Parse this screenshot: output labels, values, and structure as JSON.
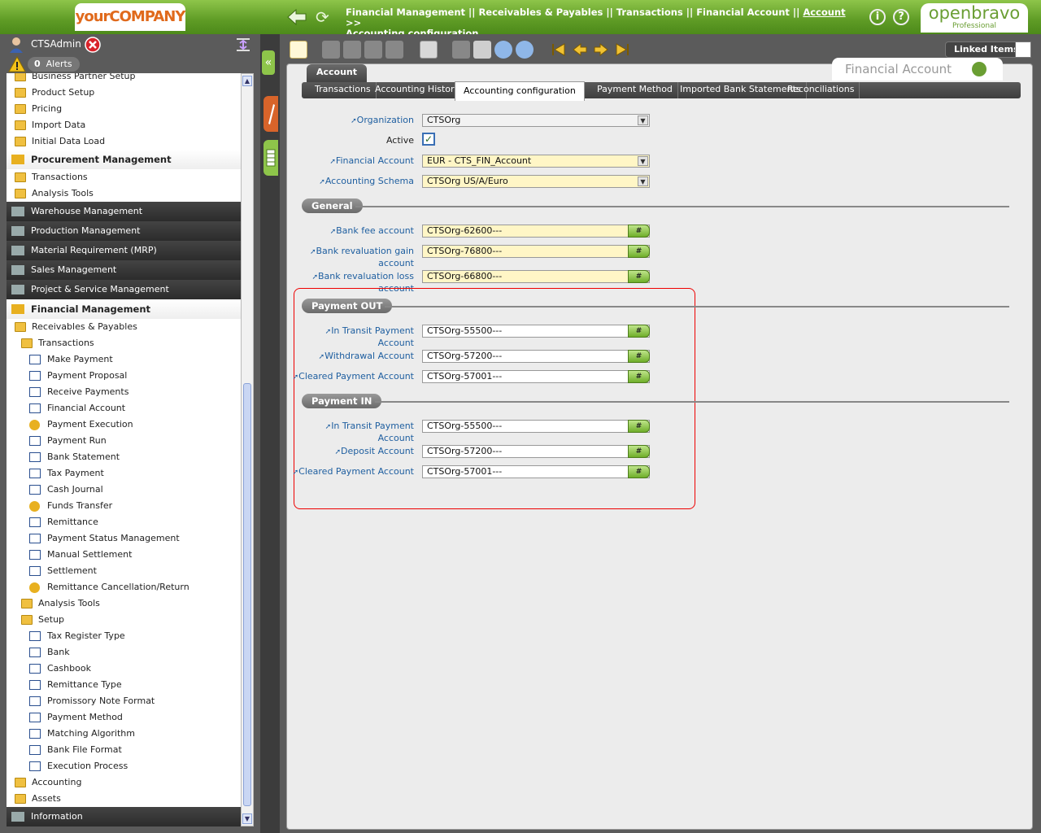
{
  "header": {
    "company_logo": "yourCOMPANY",
    "breadcrumb_line1": "Financial Management || Receivables & Payables || Transactions || Financial Account ||",
    "breadcrumb_link": "Account",
    "breadcrumb_sep": ">>",
    "breadcrumb_line2": "Accounting configuration",
    "brand_name": "openbravo",
    "brand_edition": "Professional",
    "info_label": "i",
    "help_label": "?"
  },
  "user": {
    "name": "CTSAdmin",
    "alerts_count": "0",
    "alerts_label": "Alerts"
  },
  "menu": [
    {
      "label": "Business Partner Setup",
      "type": "folder",
      "indent": 1
    },
    {
      "label": "Product Setup",
      "type": "folder",
      "indent": 1
    },
    {
      "label": "Pricing",
      "type": "folder",
      "indent": 1
    },
    {
      "label": "Import Data",
      "type": "folder",
      "indent": 1
    },
    {
      "label": "Initial Data Load",
      "type": "folder",
      "indent": 1
    },
    {
      "label": "Procurement Management",
      "type": "section"
    },
    {
      "label": "Transactions",
      "type": "folder",
      "indent": 1
    },
    {
      "label": "Analysis Tools",
      "type": "folder",
      "indent": 1
    },
    {
      "label": "Warehouse Management",
      "type": "dark"
    },
    {
      "label": "Production Management",
      "type": "dark"
    },
    {
      "label": "Material Requirement (MRP)",
      "type": "dark"
    },
    {
      "label": "Sales Management",
      "type": "dark"
    },
    {
      "label": "Project & Service Management",
      "type": "dark"
    },
    {
      "label": "Financial Management",
      "type": "section"
    },
    {
      "label": "Receivables & Payables",
      "type": "folder",
      "indent": 1
    },
    {
      "label": "Transactions",
      "type": "folder",
      "indent": 2
    },
    {
      "label": "Make Payment",
      "type": "doc",
      "indent": 3
    },
    {
      "label": "Payment Proposal",
      "type": "doc",
      "indent": 3
    },
    {
      "label": "Receive Payments",
      "type": "doc",
      "indent": 3
    },
    {
      "label": "Financial Account",
      "type": "doc",
      "indent": 3
    },
    {
      "label": "Payment Execution",
      "type": "proc",
      "indent": 3
    },
    {
      "label": "Payment Run",
      "type": "doc",
      "indent": 3
    },
    {
      "label": "Bank Statement",
      "type": "doc",
      "indent": 3
    },
    {
      "label": "Tax Payment",
      "type": "doc",
      "indent": 3
    },
    {
      "label": "Cash Journal",
      "type": "doc",
      "indent": 3
    },
    {
      "label": "Funds Transfer",
      "type": "proc",
      "indent": 3
    },
    {
      "label": "Remittance",
      "type": "doc",
      "indent": 3
    },
    {
      "label": "Payment Status Management",
      "type": "doc",
      "indent": 3
    },
    {
      "label": "Manual Settlement",
      "type": "doc",
      "indent": 3
    },
    {
      "label": "Settlement",
      "type": "doc",
      "indent": 3
    },
    {
      "label": "Remittance Cancellation/Return",
      "type": "proc",
      "indent": 3
    },
    {
      "label": "Analysis Tools",
      "type": "folder",
      "indent": 2
    },
    {
      "label": "Setup",
      "type": "folder",
      "indent": 2
    },
    {
      "label": "Tax Register Type",
      "type": "doc",
      "indent": 3
    },
    {
      "label": "Bank",
      "type": "doc",
      "indent": 3
    },
    {
      "label": "Cashbook",
      "type": "doc",
      "indent": 3
    },
    {
      "label": "Remittance Type",
      "type": "doc",
      "indent": 3
    },
    {
      "label": "Promissory Note Format",
      "type": "doc",
      "indent": 3
    },
    {
      "label": "Payment Method",
      "type": "doc",
      "indent": 3
    },
    {
      "label": "Matching Algorithm",
      "type": "doc",
      "indent": 3
    },
    {
      "label": "Bank File Format",
      "type": "doc",
      "indent": 3
    },
    {
      "label": "Execution Process",
      "type": "doc",
      "indent": 3
    },
    {
      "label": "Accounting",
      "type": "folder",
      "indent": 1
    },
    {
      "label": "Assets",
      "type": "folder",
      "indent": 1
    },
    {
      "label": "Information",
      "type": "dark"
    }
  ],
  "toolbar": {
    "linked_items": "Linked Items"
  },
  "window": {
    "tab_label": "Account",
    "window_name": "Financial Account",
    "subtabs": [
      "Transactions",
      "Accounting History",
      "Accounting configuration",
      "Payment Method",
      "Imported Bank Statements",
      "Reconciliations"
    ],
    "active_subtab": "Accounting configuration"
  },
  "form": {
    "organization": {
      "label": "Organization",
      "value": "CTSOrg"
    },
    "active": {
      "label": "Active",
      "checked": true
    },
    "financial_account": {
      "label": "Financial Account",
      "value": "EUR - CTS_FIN_Account"
    },
    "accounting_schema": {
      "label": "Accounting Schema",
      "value": "CTSOrg US/A/Euro"
    },
    "general": {
      "title": "General",
      "bank_fee": {
        "label": "Bank fee account",
        "value": "CTSOrg-62600---"
      },
      "reval_gain": {
        "label1": "Bank revaluation gain",
        "label2": "account",
        "value": "CTSOrg-76800---"
      },
      "reval_loss": {
        "label1": "Bank revaluation loss",
        "label2": "account",
        "value": "CTSOrg-66800---"
      }
    },
    "payment_out": {
      "title": "Payment OUT",
      "in_transit": {
        "label1": "In Transit Payment",
        "label2": "Account",
        "value": "CTSOrg-55500---"
      },
      "withdrawal": {
        "label": "Withdrawal Account",
        "value": "CTSOrg-57200---"
      },
      "cleared": {
        "label": "Cleared Payment Account",
        "value": "CTSOrg-57001---"
      }
    },
    "payment_in": {
      "title": "Payment IN",
      "in_transit": {
        "label1": "In Transit Payment",
        "label2": "Account",
        "value": "CTSOrg-55500---"
      },
      "deposit": {
        "label": "Deposit Account",
        "value": "CTSOrg-57200---"
      },
      "cleared": {
        "label": "Cleared Payment Account",
        "value": "CTSOrg-57001---"
      }
    },
    "search_glyph": "#"
  },
  "colors": {
    "brand_green": "#6a9e33",
    "highlight_red": "#ee0000",
    "required_yellow": "#fff6c6"
  }
}
